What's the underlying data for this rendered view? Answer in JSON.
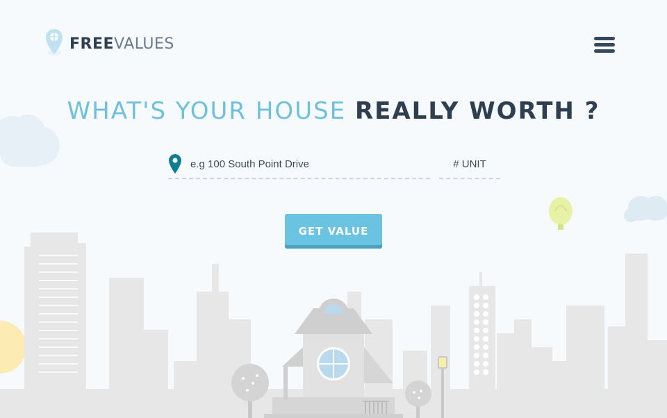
{
  "brand": {
    "name_strong": "FREE",
    "name_light": "VALUES",
    "icon": "map-pin-icon"
  },
  "nav": {
    "menu_icon": "hamburger-menu-icon"
  },
  "hero": {
    "title_part1": "WHAT'S YOUR HOUSE",
    "title_part2": "REALLY WORTH ?"
  },
  "search": {
    "address_placeholder": "e.g 100 South Point Drive",
    "unit_placeholder": "# UNIT",
    "button_label": "GET VALUE",
    "location_icon": "location-pin-icon"
  },
  "colors": {
    "accent": "#6fc0dd",
    "button": "#6ac3e0",
    "dark_text": "#2f3f52",
    "pin": "#0f7d96",
    "city": "#e5e5e5"
  }
}
